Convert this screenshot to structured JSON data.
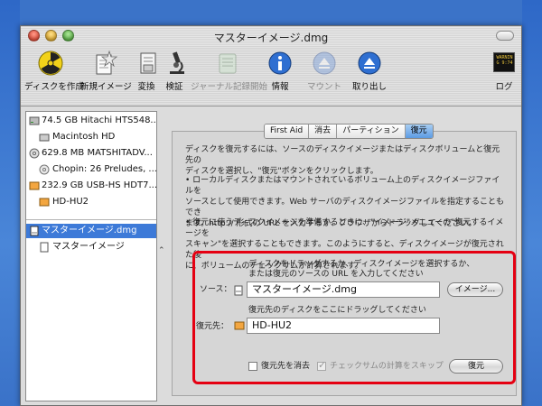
{
  "window": {
    "title": "マスターイメージ.dmg"
  },
  "toolbar": {
    "items": [
      {
        "label": "ディスクを作成",
        "icon": "burn-disc-icon",
        "enabled": true
      },
      {
        "label": "新規イメージ",
        "icon": "new-image-icon",
        "enabled": true
      },
      {
        "label": "変換",
        "icon": "convert-icon",
        "enabled": true
      },
      {
        "label": "検証",
        "icon": "verify-microscope-icon",
        "enabled": true
      },
      {
        "label": "ジャーナル記録開始",
        "icon": "journaling-icon",
        "enabled": false
      },
      {
        "label": "情報",
        "icon": "info-icon",
        "enabled": true
      },
      {
        "label": "マウント",
        "icon": "mount-icon",
        "enabled": false
      },
      {
        "label": "取り出し",
        "icon": "eject-icon",
        "enabled": true
      },
      {
        "label": "ログ",
        "icon": "log-icon",
        "enabled": true
      }
    ],
    "log_icon_text": "WARNIN\nG 9:74"
  },
  "sidebar": {
    "items": [
      {
        "label": "74.5 GB Hitachi HTS548...",
        "icon": "hard-disk-icon",
        "level": 0,
        "selected": false
      },
      {
        "label": "Macintosh HD",
        "icon": "volume-icon",
        "level": 1,
        "selected": false
      },
      {
        "label": "629.8 MB MATSHITADV...",
        "icon": "optical-drive-icon",
        "level": 0,
        "selected": false
      },
      {
        "label": "Chopin: 26 Preludes, ...",
        "icon": "cd-icon",
        "level": 1,
        "selected": false
      },
      {
        "label": "232.9 GB USB-HS HDT7...",
        "icon": "external-disk-icon",
        "level": 0,
        "selected": false
      },
      {
        "label": "HD-HU2",
        "icon": "external-volume-icon",
        "level": 1,
        "selected": false
      },
      {
        "label": "マスターイメージ.dmg",
        "icon": "disk-image-icon",
        "level": 0,
        "selected": true
      },
      {
        "label": "マスターイメージ",
        "icon": "image-volume-icon",
        "level": 1,
        "selected": false
      }
    ]
  },
  "tabs": [
    {
      "label": "First Aid",
      "active": false
    },
    {
      "label": "消去",
      "active": false
    },
    {
      "label": "パーティション",
      "active": false
    },
    {
      "label": "復元",
      "active": true
    }
  ],
  "restore": {
    "desc1_line1": "ディスクを復元するには、ソースのディスクイメージまたはディスクボリュームと復元先の",
    "desc1_line2": "ディスクを選択し、\"復元\"ボタンをクリックします。",
    "desc2_line1": "• ローカルディスクまたはマウントされているボリューム上のディスクイメージファイルを",
    "desc2_line2": "ソースとして使用できます。Web サーバのディスクイメージファイルを指定することもでき",
    "desc2_line3": "ます。http:// 形式の URL を入力するか、ブラウザからドラッグしてください。",
    "desc3_line1": "• 復元に使うディスクイメージを準備するときに、\"イメージ\"メニューの\"復元するイメージを",
    "desc3_line2": "スキャン\"を選択することもできます。このようにすると、ディスクイメージが復元された後",
    "desc3_line3": "に、ボリュームのチェックサムが計算されます。",
    "source_hint_line1": "ディスクをドラッグするか、ディスクイメージを選択するか、",
    "source_hint_line2": "または復元のソースの URL を入力してください",
    "source_label": "ソース：",
    "source_value": "マスターイメージ.dmg",
    "image_button": "イメージ...",
    "dest_hint": "復元先のディスクをここにドラッグしてください",
    "dest_label": "復元先：",
    "dest_value": "HD-HU2",
    "erase_dest_label": "復元先を消去",
    "erase_dest_checked": false,
    "skip_checksum_label": "チェックサムの計算をスキップ",
    "skip_checksum_checked": true,
    "skip_checksum_enabled": false,
    "restore_button": "復元"
  },
  "colors": {
    "highlight_border": "#e50012",
    "selection": "#3d7ad8",
    "desktop": "#3b73c8"
  }
}
